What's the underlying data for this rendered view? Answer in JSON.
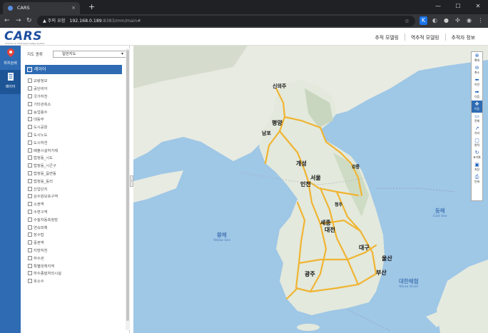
{
  "browser": {
    "tab_title": "CARS",
    "tab_close": "×",
    "new_tab": "+",
    "window_buttons": [
      "—",
      "☐",
      "✕"
    ],
    "nav": {
      "back": "←",
      "forward": "→",
      "reload": "↻"
    },
    "security_label": "▲ 주의 요함",
    "url_host": "192.168.0.189",
    "url_path": ":8383/mm/main#"
  },
  "app": {
    "logo": "CARS",
    "logo_sub": "Children & Adult Road Safety System",
    "menu": [
      "추적 모델링",
      "역추적 모델링",
      "추적자 정보"
    ]
  },
  "rail": [
    {
      "label": "위치검색",
      "icon": "location-pin-icon"
    },
    {
      "label": "레이어",
      "icon": "layers-icon"
    }
  ],
  "panel": {
    "map_type_label": "지도 종류",
    "map_type_value": "일반지도",
    "layer_title": "레이어",
    "layers": [
      "교량정보",
      "공단비아",
      "국가하천",
      "기타관측소",
      "농업용수",
      "대동부",
      "도시공원",
      "도시노도",
      "도시하천",
      "배출시설허가제",
      "법정동_시도",
      "법정동_시군구",
      "법정동_읍면동",
      "법정동_동리",
      "산업단지",
      "상수원보호구역",
      "소권역",
      "수변구역",
      "수질자동측정망",
      "연속피해",
      "장수탑",
      "중권역",
      "지방하천",
      "하수관",
      "특별대책지역",
      "하수종말처리시설",
      "호소수"
    ]
  },
  "map": {
    "labels": [
      {
        "text": "신의주"
      },
      {
        "text": "평양"
      },
      {
        "text": "남포"
      },
      {
        "text": "개성"
      },
      {
        "text": "서울"
      },
      {
        "text": "인천"
      },
      {
        "text": "세종"
      },
      {
        "text": "대전"
      },
      {
        "text": "대구"
      },
      {
        "text": "울산"
      },
      {
        "text": "광주"
      },
      {
        "text": "부산"
      },
      {
        "text": "청주"
      },
      {
        "text": "강릉"
      }
    ],
    "seas": [
      {
        "text": "황해",
        "sub": "Yellow Sea"
      },
      {
        "text": "동해",
        "sub": "East Sea"
      },
      {
        "text": "대한해협",
        "sub": "Korea Strait"
      }
    ],
    "colors": {
      "sea": "#9fc7e6",
      "land": "#e6ebe0",
      "road": "#f0b432",
      "brand": "#2e6bb3"
    }
  },
  "tools": [
    {
      "label": "확대",
      "icon": "zoom-in-icon"
    },
    {
      "label": "축소",
      "icon": "zoom-out-icon"
    },
    {
      "label": "이전",
      "icon": "arrow-left-icon"
    },
    {
      "label": "다음",
      "icon": "arrow-right-icon"
    },
    {
      "label": "이동",
      "icon": "move-icon"
    },
    {
      "label": "전체",
      "icon": "full-extent-icon"
    },
    {
      "label": "거리",
      "icon": "distance-icon"
    },
    {
      "label": "면적",
      "icon": "area-icon"
    },
    {
      "label": "초기화",
      "icon": "reset-icon"
    },
    {
      "label": "저장",
      "icon": "save-icon"
    },
    {
      "label": "인쇄",
      "icon": "print-icon"
    }
  ]
}
